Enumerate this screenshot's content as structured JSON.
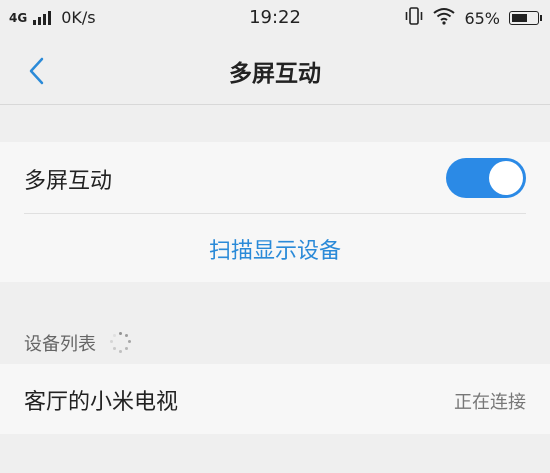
{
  "status_bar": {
    "network": "4G",
    "speed": "0K/s",
    "time": "19:22",
    "battery": "65%",
    "battery_level": 0.65,
    "icons": [
      "signal-icon",
      "vibrate-icon",
      "wifi-icon",
      "battery-icon"
    ]
  },
  "header": {
    "title": "多屏互动",
    "back_icon": "chevron-left-icon"
  },
  "settings": {
    "toggle_label": "多屏互动",
    "toggle_on": true,
    "scan_label": "扫描显示设备"
  },
  "device_list": {
    "header": "设备列表",
    "items": [
      {
        "name": "客厅的小米电视",
        "status": "正在连接"
      }
    ]
  },
  "colors": {
    "accent": "#2b8ae6",
    "link": "#2a8ad8",
    "background": "#efefef",
    "card": "#f7f7f7"
  }
}
